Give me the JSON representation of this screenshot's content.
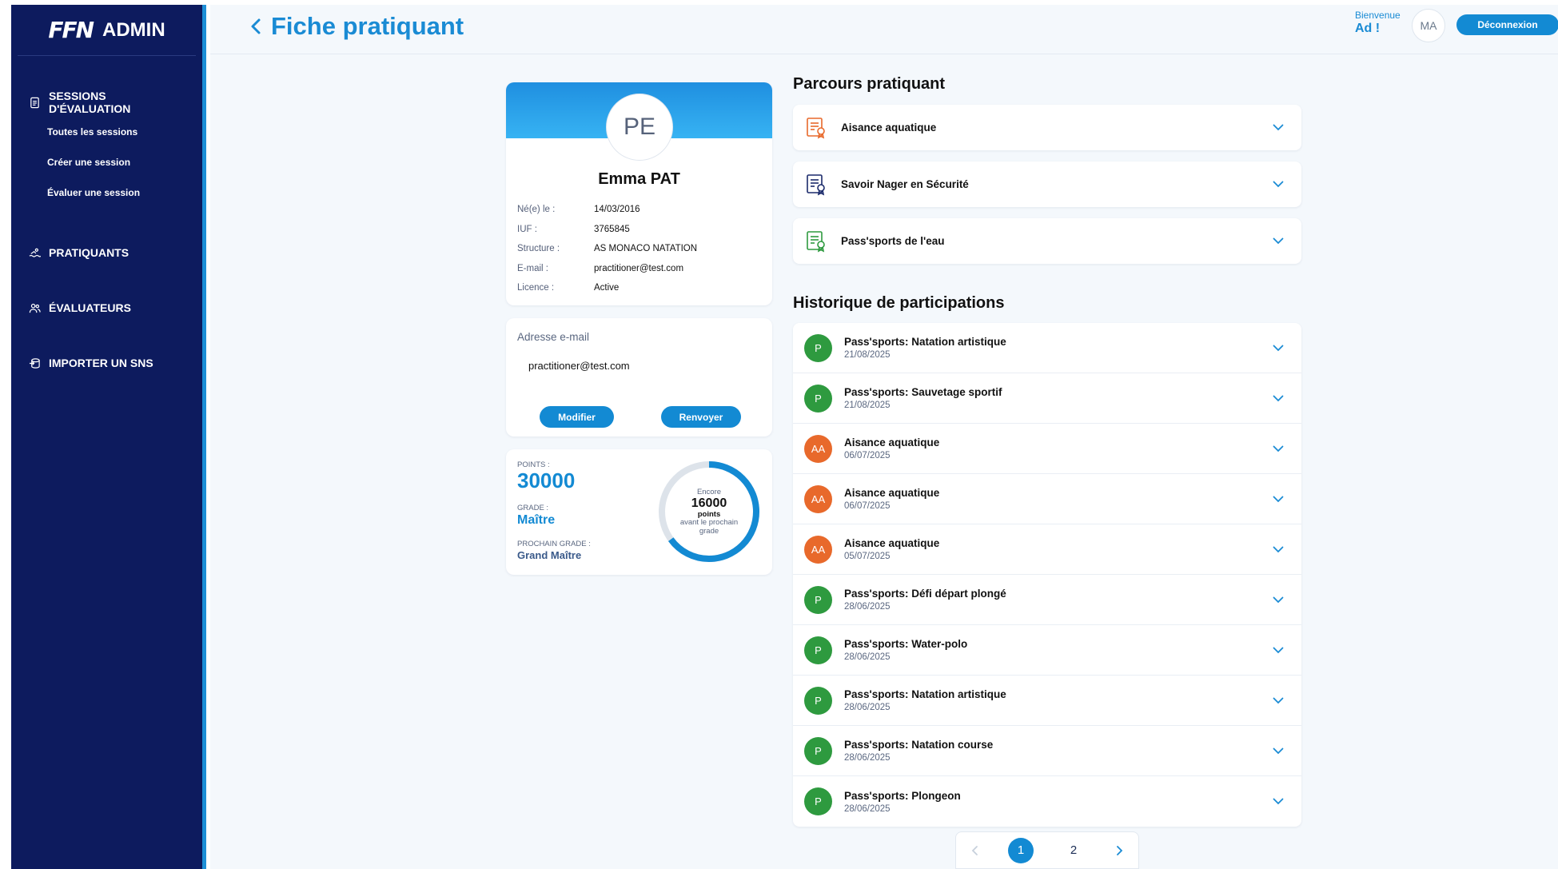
{
  "sidebar": {
    "logo_mark": "FFN",
    "logo_text": "ADMIN",
    "sessions": {
      "label": "SESSIONS D'ÉVALUATION",
      "items": [
        "Toutes les sessions",
        "Créer une session",
        "Évaluer une session"
      ]
    },
    "pratiquants": "PRATIQUANTS",
    "evaluateurs": "ÉVALUATEURS",
    "importer": "IMPORTER UN SNS"
  },
  "header": {
    "title": "Fiche pratiquant",
    "welcome": "Bienvenue",
    "user": "Ad !",
    "avatar": "MA",
    "logout": "Déconnexion"
  },
  "profile": {
    "initials": "PE",
    "name": "Emma PAT",
    "fields": [
      {
        "label": "Né(e) le :",
        "value": "14/03/2016"
      },
      {
        "label": "IUF :",
        "value": "3765845"
      },
      {
        "label": "Structure :",
        "value": "AS MONACO NATATION"
      },
      {
        "label": "E-mail :",
        "value": "practitioner@test.com"
      },
      {
        "label": "Licence :",
        "value": "Active"
      }
    ]
  },
  "email_card": {
    "title": "Adresse e-mail",
    "value": "practitioner@test.com",
    "modify": "Modifier",
    "resend": "Renvoyer"
  },
  "points": {
    "points_label": "POINTS :",
    "points_value": "30000",
    "grade_label": "GRADE :",
    "grade_value": "Maître",
    "next_label": "PROCHAIN GRADE :",
    "next_value": "Grand Maître",
    "ring_top": "Encore",
    "ring_number": "16000",
    "ring_unit": "points",
    "ring_bottom": "avant le prochain grade",
    "progress_fraction": 0.65,
    "color_track": "#dde3ea",
    "color_fill": "#138ad3"
  },
  "parcours": {
    "title": "Parcours pratiquant",
    "items": [
      {
        "label": "Aisance aquatique",
        "color": "#e8692b",
        "icon": "certificate-icon"
      },
      {
        "label": "Savoir Nager en Sécurité",
        "color": "#1b2a6b",
        "icon": "certificate-icon"
      },
      {
        "label": "Pass'sports de l'eau",
        "color": "#2e9a3f",
        "icon": "certificate-icon"
      }
    ]
  },
  "historique": {
    "title": "Historique de participations",
    "items": [
      {
        "badge": "P",
        "color": "#2e9a3f",
        "title": "Pass'sports: Natation artistique",
        "date": "21/08/2025"
      },
      {
        "badge": "P",
        "color": "#2e9a3f",
        "title": "Pass'sports: Sauvetage sportif",
        "date": "21/08/2025"
      },
      {
        "badge": "AA",
        "color": "#e8692b",
        "title": "Aisance aquatique",
        "date": "06/07/2025"
      },
      {
        "badge": "AA",
        "color": "#e8692b",
        "title": "Aisance aquatique",
        "date": "06/07/2025"
      },
      {
        "badge": "AA",
        "color": "#e8692b",
        "title": "Aisance aquatique",
        "date": "05/07/2025"
      },
      {
        "badge": "P",
        "color": "#2e9a3f",
        "title": "Pass'sports: Défi départ plongé",
        "date": "28/06/2025"
      },
      {
        "badge": "P",
        "color": "#2e9a3f",
        "title": "Pass'sports: Water-polo",
        "date": "28/06/2025"
      },
      {
        "badge": "P",
        "color": "#2e9a3f",
        "title": "Pass'sports: Natation artistique",
        "date": "28/06/2025"
      },
      {
        "badge": "P",
        "color": "#2e9a3f",
        "title": "Pass'sports: Natation course",
        "date": "28/06/2025"
      },
      {
        "badge": "P",
        "color": "#2e9a3f",
        "title": "Pass'sports: Plongeon",
        "date": "28/06/2025"
      }
    ]
  },
  "pagination": {
    "pages": [
      "1",
      "2"
    ],
    "current": "1"
  }
}
